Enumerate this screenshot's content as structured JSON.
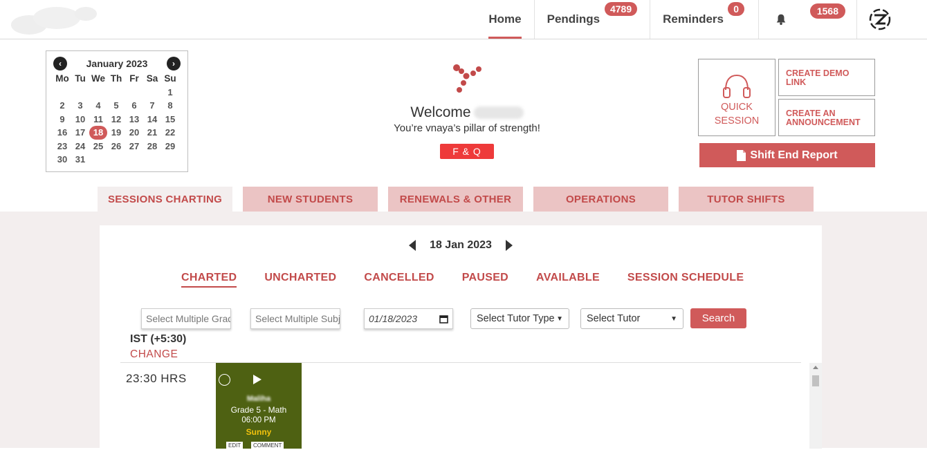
{
  "nav": {
    "home": "Home",
    "pendings": "Pendings",
    "pendings_count": "4789",
    "reminders": "Reminders",
    "reminders_count": "0",
    "notifications_count": "1568"
  },
  "calendar": {
    "title": "January 2023",
    "weekdays": [
      "Mo",
      "Tu",
      "We",
      "Th",
      "Fr",
      "Sa",
      "Su"
    ],
    "selected_day": "18"
  },
  "welcome": {
    "greeting": "Welcome",
    "tagline": "You’re vnaya’s pillar of strength!",
    "fq_label": "F & Q"
  },
  "actions": {
    "quick_session_line1": "QUICK",
    "quick_session_line2": "SESSION",
    "create_demo_link": "CREATE DEMO LINK",
    "create_announcement": "CREATE AN ANNOUNCEMENT",
    "shift_end_report": "Shift End Report"
  },
  "tabs": [
    "SESSIONS CHARTING",
    "NEW STUDENTS",
    "RENEWALS & OTHER",
    "OPERATIONS",
    "TUTOR SHIFTS"
  ],
  "session": {
    "date": "18 Jan 2023",
    "subtabs": [
      "CHARTED",
      "UNCHARTED",
      "CANCELLED",
      "PAUSED",
      "AVAILABLE",
      "SESSION SCHEDULE"
    ]
  },
  "filters": {
    "grade_placeholder": "Select Multiple Grade",
    "subject_placeholder": "Select Multiple Subje",
    "date_value": "01/18/2023",
    "tutor_type": "Select Tutor Type",
    "tutor": "Select Tutor",
    "search": "Search"
  },
  "timezone": {
    "label": "IST (+5:30)",
    "change": "CHANGE"
  },
  "timeline": {
    "slot_label": "23:30 HRS",
    "card": {
      "student": "Maliha",
      "subject": "Grade 5 - Math",
      "time": "06:00 PM",
      "tutor": "Sunny",
      "edit": "EDIT",
      "comment": "COMMENT"
    }
  },
  "colors": {
    "accent": "#d05a5a",
    "tab_bg": "#ebc4c4",
    "card_bg": "#4e6112",
    "fq_bg": "#ee3a3a"
  }
}
